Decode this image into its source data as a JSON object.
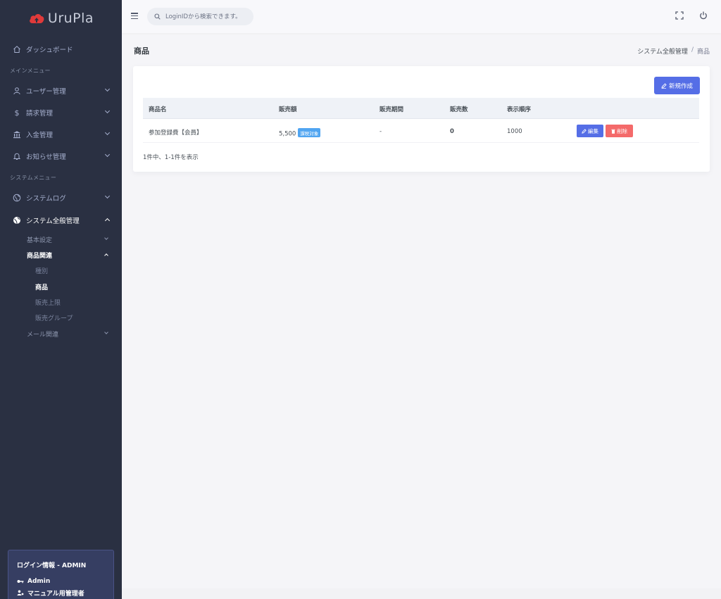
{
  "brand": {
    "name": "UruPla",
    "accent": "#e03a3a"
  },
  "topbar": {
    "search_placeholder": "LoginIDから検索できます。",
    "icons": [
      "menu-icon",
      "search-icon",
      "fullscreen-icon",
      "power-icon"
    ]
  },
  "sidebar": {
    "dashboard": "ダッシュボード",
    "main_menu_title": "メインメニュー",
    "users": "ユーザー管理",
    "billing": "請求管理",
    "payments": "入金管理",
    "notices": "お知らせ管理",
    "system_menu_title": "システムメニュー",
    "system_log": "システムログ",
    "system_general": "システム全般管理",
    "basic_settings": "基本設定",
    "product_related": "商品関連",
    "category": "種別",
    "product": "商品",
    "sales_limit": "販売上限",
    "sales_group": "販売グループ",
    "mail_related": "メール関連"
  },
  "login_info": {
    "title": "ログイン情報 - ADMIN",
    "user": "Admin",
    "role": "マニュアル用管理者"
  },
  "page": {
    "title": "商品",
    "breadcrumb_parent": "システム全般管理",
    "breadcrumb_separator": "/",
    "breadcrumb_current": "商品"
  },
  "table": {
    "new_button": "新規作成",
    "headers": [
      "商品名",
      "販売額",
      "販売期間",
      "販売数",
      "表示順序"
    ],
    "rows": [
      {
        "name": "参加登録費【会員】",
        "price": "5,500",
        "tax_badge": "課税対象",
        "period": "-",
        "count": "0",
        "order": "1000",
        "edit": "編集",
        "delete": "削除"
      }
    ],
    "summary": "1件中、1-1件を表示"
  }
}
